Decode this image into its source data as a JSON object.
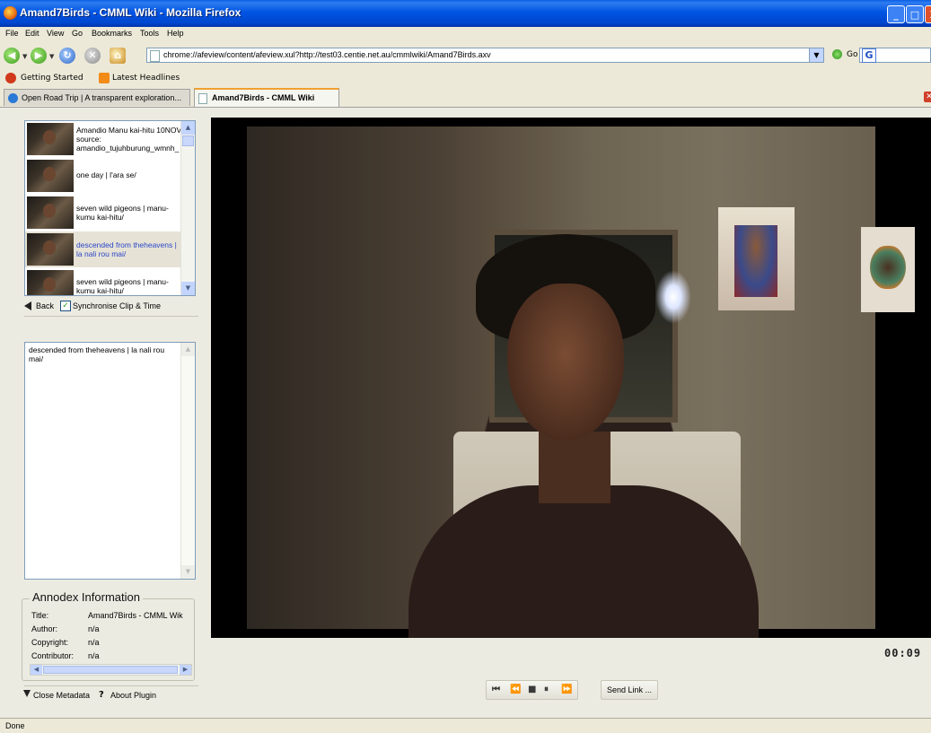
{
  "window": {
    "title": "Amand7Birds - CMML Wiki - Mozilla Firefox",
    "buttons": [
      "_",
      "□",
      "X"
    ]
  },
  "menubar": [
    "File",
    "Edit",
    "View",
    "Go",
    "Bookmarks",
    "Tools",
    "Help"
  ],
  "navbar": {
    "url": "chrome://afeview/content/afeview.xul?http://test03.centie.net.au/cmmlwiki/Amand7Birds.axv",
    "go_label": "Go",
    "search_logo": "G"
  },
  "bookmarks": [
    "Getting Started",
    "Latest Headlines"
  ],
  "tabs": [
    {
      "label": "Open Road Trip | A transparent exploration...",
      "active": false
    },
    {
      "label": "Amand7Birds - CMML Wiki",
      "active": true
    }
  ],
  "clips": [
    {
      "text": "Amandio Manu kai-hitu 10NOV source: amandio_tujuhburung_wmnh_",
      "selected": false
    },
    {
      "text": "one day | l'ara se/",
      "selected": false
    },
    {
      "text": "seven wild pigeons | manu-kumu kai-hitu/",
      "selected": false
    },
    {
      "text": "descended from theheavens | la nali rou mai/",
      "selected": true
    },
    {
      "text": "seven wild pigeons | manu-kumu kai-hitu/",
      "selected": false
    }
  ],
  "clip_controls": {
    "back_label": "Back",
    "sync_label": "Synchronise Clip & Time",
    "sync_checked": true
  },
  "description": "descended from theheavens | la nali rou mai/",
  "metadata": {
    "legend": "Annodex Information",
    "rows": [
      {
        "key": "Title:",
        "value": "Amand7Birds - CMML Wik"
      },
      {
        "key": "Author:",
        "value": "n/a"
      },
      {
        "key": "Copyright:",
        "value": "n/a"
      },
      {
        "key": "Contributor:",
        "value": "n/a"
      }
    ]
  },
  "footer": {
    "close_metadata": "Close Metadata",
    "about_icon": "?",
    "about_plugin": "About Plugin"
  },
  "player": {
    "timecode": "00:09",
    "buttons": [
      "⏮",
      "⏪",
      "■",
      "⏸",
      "⏩"
    ],
    "send_link": "Send Link ..."
  },
  "status": "Done",
  "colors": {
    "titlebar": "#0054e3",
    "selected_clip_text": "#2b45c8",
    "chrome_bg": "#ece9d8"
  }
}
